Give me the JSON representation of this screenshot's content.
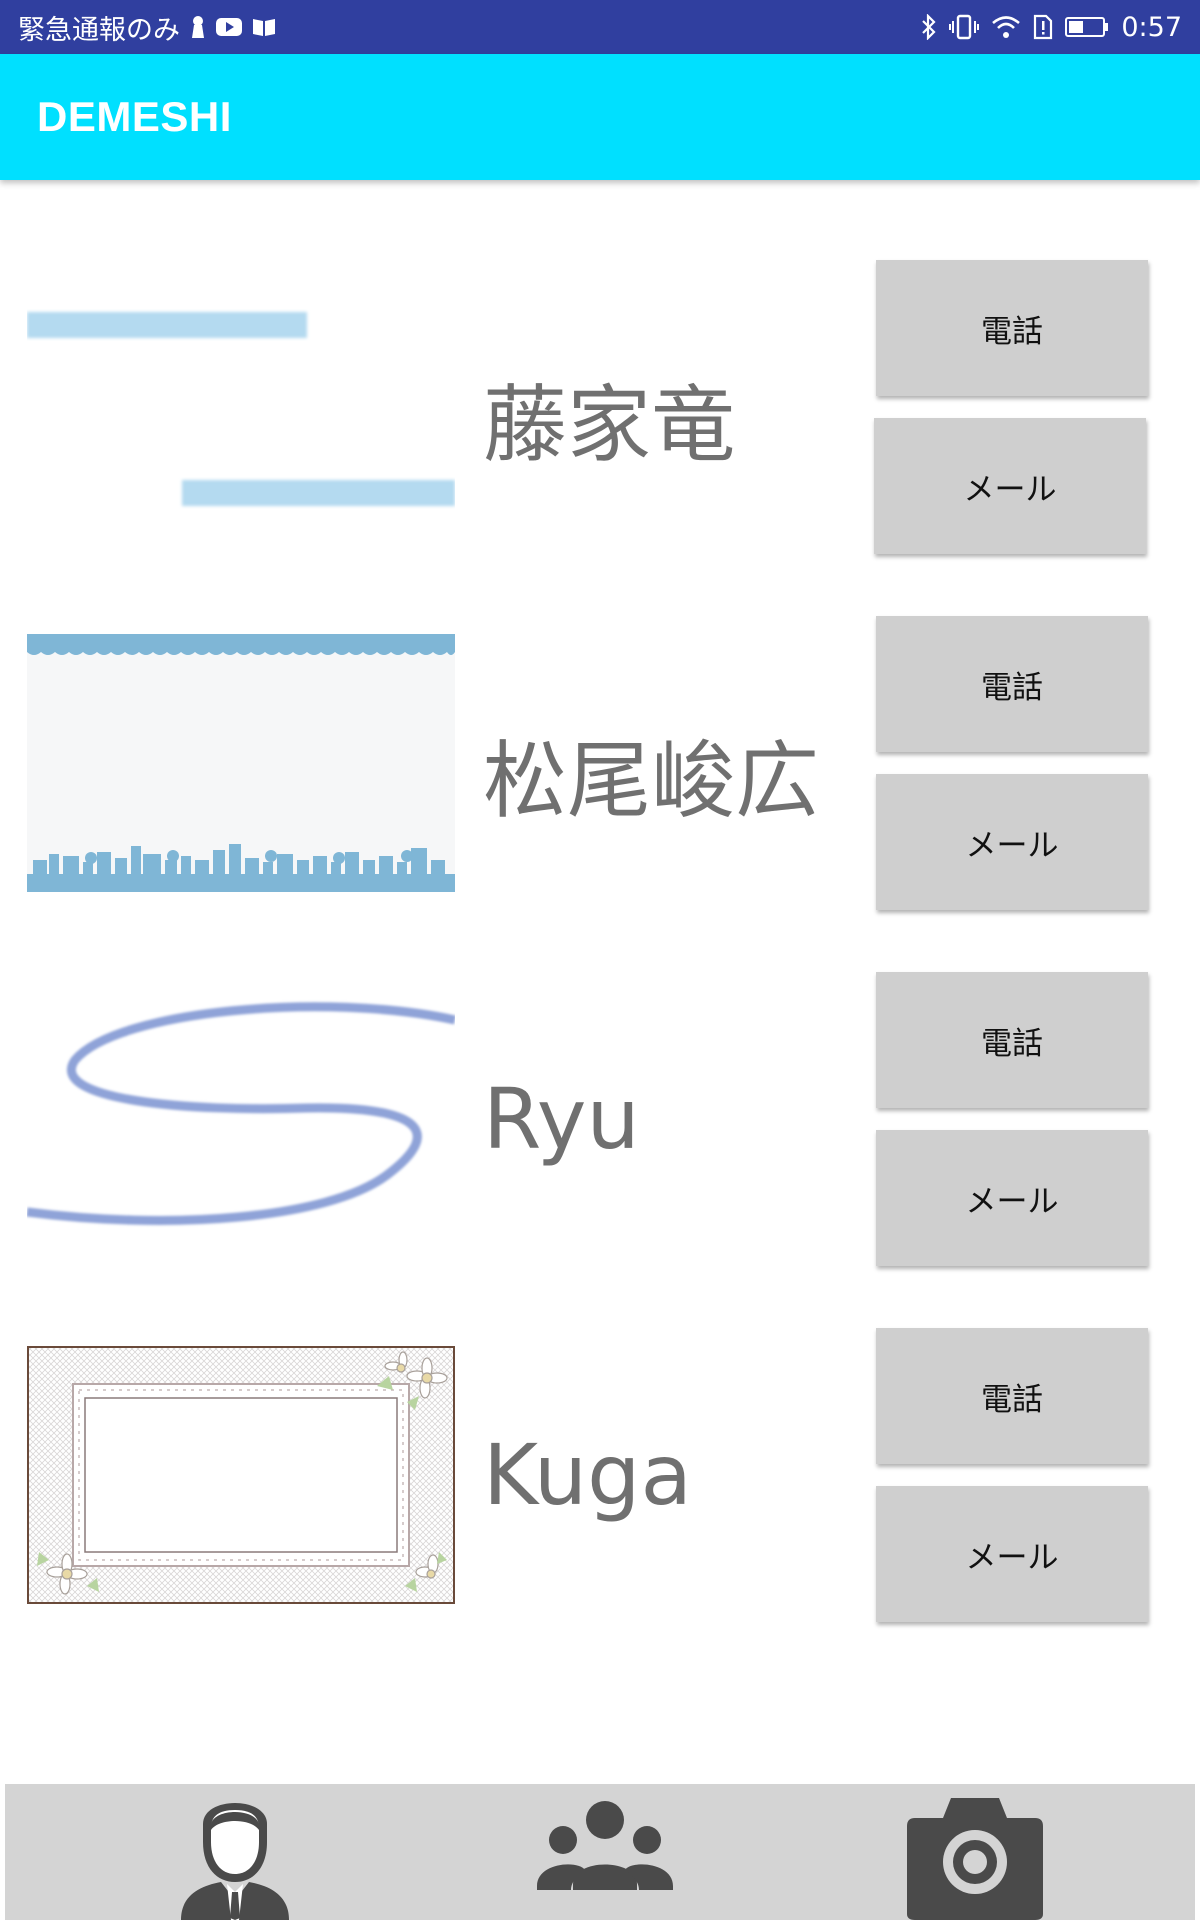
{
  "status_bar": {
    "left_text": "緊急通報のみ",
    "time": "0:57",
    "icons_left": [
      "keyhole-icon",
      "youtube-icon",
      "book-icon"
    ],
    "icons_right": [
      "bluetooth-icon",
      "vibrate-icon",
      "wifi-icon",
      "sim-alert-icon",
      "battery-icon"
    ]
  },
  "app_bar": {
    "title": "DEMESHI"
  },
  "contacts": [
    {
      "name": "藤家竜",
      "card_style": "blue-stripes",
      "call_label": "電話",
      "mail_label": "メール"
    },
    {
      "name": "松尾峻広",
      "card_style": "town-skyline",
      "call_label": "電話",
      "mail_label": "メール"
    },
    {
      "name": "Ryu",
      "card_style": "blue-swoosh",
      "call_label": "電話",
      "mail_label": "メール"
    },
    {
      "name": "Kuga",
      "card_style": "floral-frame",
      "call_label": "電話",
      "mail_label": "メール"
    }
  ],
  "bottom_nav": {
    "items": [
      "person-icon",
      "group-icon",
      "camera-icon"
    ]
  },
  "colors": {
    "status_bar": "#303f9f",
    "app_bar": "#00e0ff",
    "button": "#cfcfcf",
    "name_text": "#707070",
    "nav_bg": "#d4d4d4",
    "nav_icon": "#4a4a4a"
  }
}
